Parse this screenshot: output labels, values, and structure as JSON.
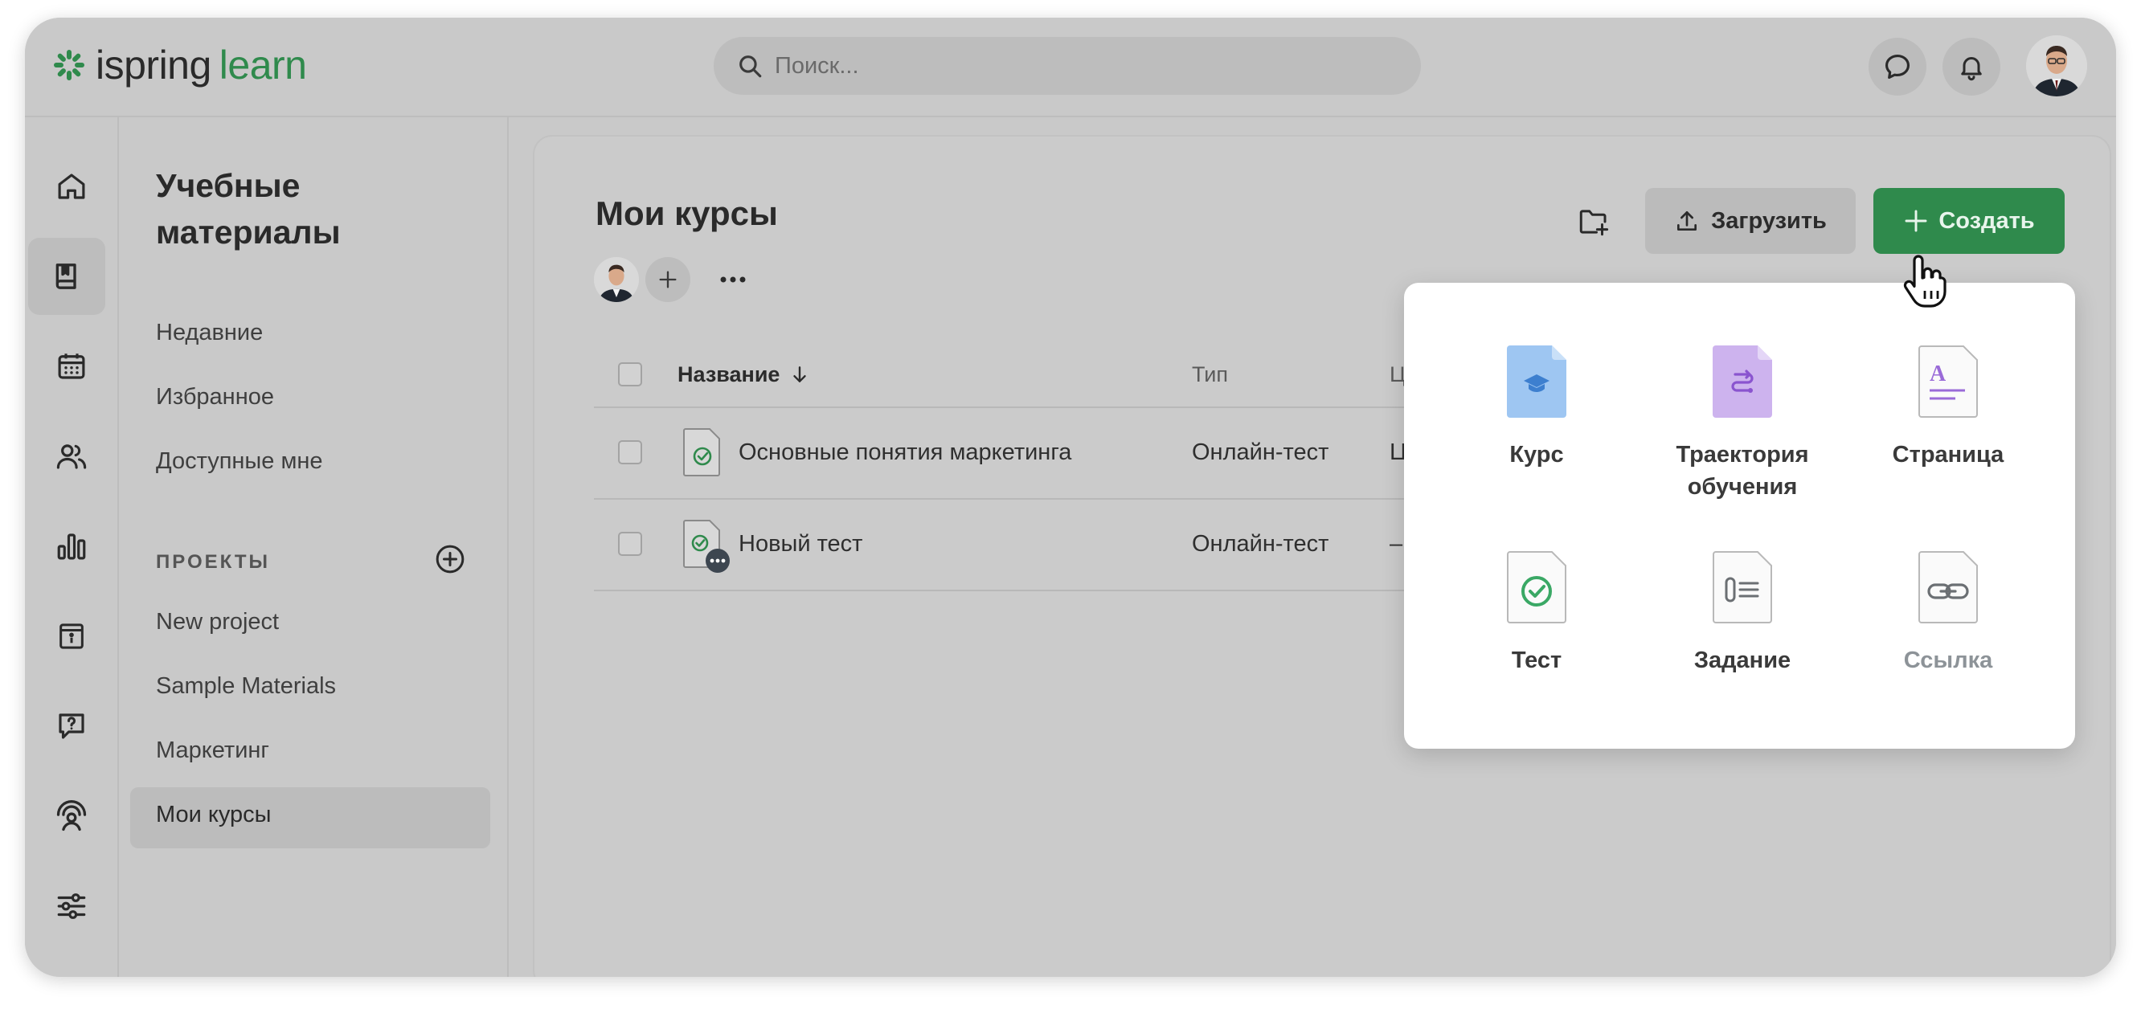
{
  "app": {
    "logo_brand": "ispring",
    "logo_product": "learn",
    "brand_color": "#2f8a4c"
  },
  "search": {
    "placeholder": "Поиск..."
  },
  "topbar_icons": [
    "chat-icon",
    "bell-icon",
    "user-avatar"
  ],
  "rail": {
    "items": [
      "home-icon",
      "book-icon",
      "calendar-icon",
      "users-icon",
      "bar-chart-icon",
      "info-board-icon",
      "help-chat-icon",
      "webcam-user-icon",
      "sliders-icon"
    ],
    "active": "book-icon"
  },
  "sidebar": {
    "title": "Учебные материалы",
    "links": [
      "Недавние",
      "Избранное",
      "Доступные мне"
    ],
    "projects_label": "ПРОЕКТЫ",
    "projects": [
      "New project",
      "Sample Materials",
      "Маркетинг",
      "Мои курсы"
    ],
    "active_project": "Мои курсы"
  },
  "main": {
    "title": "Мои курсы",
    "upload_label": "Загрузить",
    "create_label": "Создать"
  },
  "table": {
    "columns": [
      "Название",
      "Тип",
      "Ц"
    ],
    "rows": [
      {
        "name": "Основные понятия маркетинга",
        "type": "Онлайн-тест",
        "extra": "Ц"
      },
      {
        "name": "Новый тест",
        "type": "Онлайн-тест",
        "extra": "–"
      }
    ]
  },
  "create_menu": {
    "items": [
      {
        "label": "Курс",
        "icon": "course-icon",
        "color": "#9ec6f2"
      },
      {
        "label": "Траектория обучения",
        "icon": "learning-path-icon",
        "color": "#cdb3ee"
      },
      {
        "label": "Страница",
        "icon": "page-icon",
        "color": "#9a6bd8"
      },
      {
        "label": "Тест",
        "icon": "test-icon",
        "color": "#3aa865"
      },
      {
        "label": "Задание",
        "icon": "assignment-icon",
        "color": "#6b6f73"
      },
      {
        "label": "Ссылка",
        "icon": "link-icon",
        "color": "#8d9398"
      }
    ]
  }
}
